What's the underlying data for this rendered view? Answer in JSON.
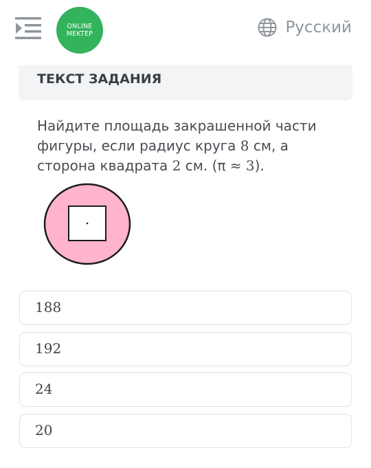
{
  "header": {
    "logo_line1": "ONLINE",
    "logo_line2": "MEKTEP",
    "language": "Русский",
    "menu_icon": "menu-collapse-icon",
    "language_icon": "globe-icon"
  },
  "task": {
    "header_title": "ТЕКСТ ЗАДАНИЯ",
    "question_part1": "Найдите площадь закрашенной части фигуры, если радиус круга ",
    "radius_value": "8",
    "question_part2": " см, а сторона квадрата ",
    "side_value": "2",
    "question_part3": " см. (π ≈ ",
    "pi_value": "3",
    "question_part4": ")."
  },
  "figure": {
    "circle_fill": "#ffb3cf",
    "square_fill": "#ffffff"
  },
  "answers": [
    {
      "label": "188"
    },
    {
      "label": "192"
    },
    {
      "label": "24"
    },
    {
      "label": "20"
    }
  ],
  "colors": {
    "logo_green": "#33b35c",
    "icon_gray": "#8e959c",
    "header_bg": "#f3f4f6",
    "border": "#dfe2e6"
  }
}
